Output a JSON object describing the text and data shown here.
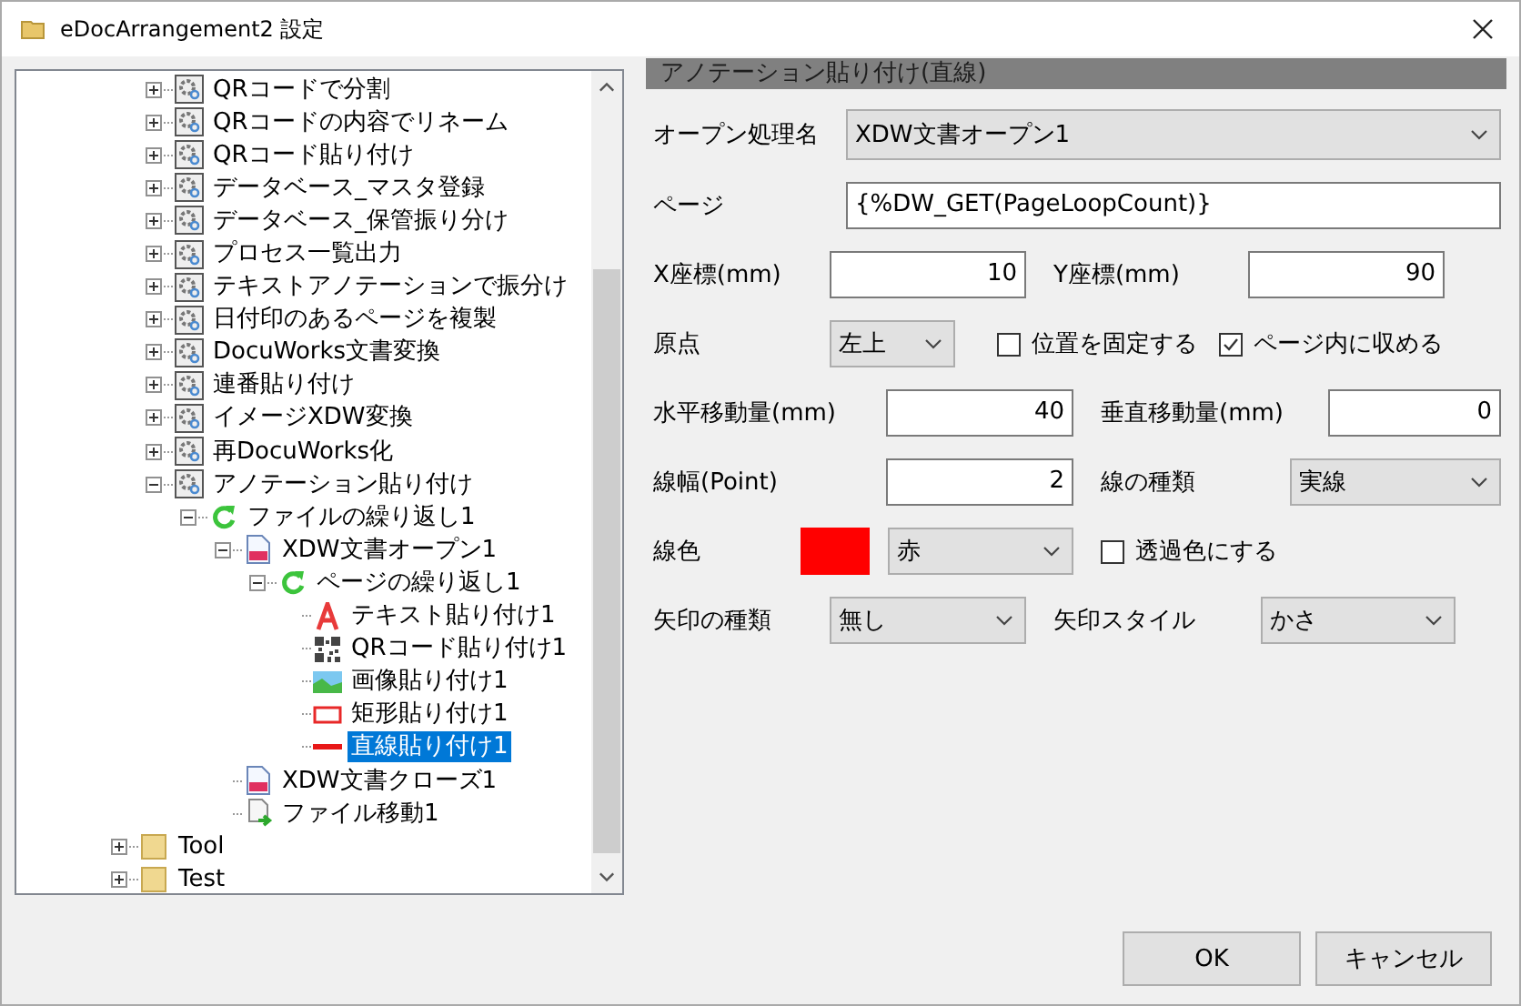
{
  "window": {
    "title": "eDocArrangement2 設定"
  },
  "tree": {
    "items": [
      {
        "children": [
          {
            "label": "QRコードで分割",
            "kind": "gear",
            "expanded": false,
            "selected": false
          },
          {
            "label": "QRコードの内容でリネーム",
            "kind": "gear",
            "expanded": false,
            "selected": false
          },
          {
            "label": "QRコード貼り付け",
            "kind": "gear",
            "expanded": false,
            "selected": false
          },
          {
            "label": "データベース_マスタ登録",
            "kind": "gear",
            "expanded": false,
            "selected": false
          },
          {
            "label": "データベース_保管振り分け",
            "kind": "gear",
            "expanded": false,
            "selected": false
          },
          {
            "label": "プロセス一覧出力",
            "kind": "gear",
            "expanded": false,
            "selected": false
          },
          {
            "label": "テキストアノテーションで振分け",
            "kind": "gear",
            "expanded": false,
            "selected": false
          },
          {
            "label": "日付印のあるページを複製",
            "kind": "gear",
            "expanded": false,
            "selected": false
          },
          {
            "label": "DocuWorks文書変換",
            "kind": "gear",
            "expanded": false,
            "selected": false
          },
          {
            "label": "連番貼り付け",
            "kind": "gear",
            "expanded": false,
            "selected": false
          },
          {
            "label": "イメージXDW変換",
            "kind": "gear",
            "expanded": false,
            "selected": false
          },
          {
            "label": "再DocuWorks化",
            "kind": "gear",
            "expanded": false,
            "selected": false
          },
          {
            "label": "アノテーション貼り付け",
            "kind": "gear",
            "expanded": true,
            "selected": false,
            "children": [
              {
                "label": "ファイルの繰り返し1",
                "kind": "loop",
                "expanded": true,
                "selected": false,
                "children": [
                  {
                    "label": "XDW文書オープン1",
                    "kind": "doc",
                    "expanded": true,
                    "selected": false,
                    "children": [
                      {
                        "label": "ページの繰り返し1",
                        "kind": "loop",
                        "expanded": true,
                        "selected": false,
                        "children": [
                          {
                            "label": "テキスト貼り付け1",
                            "kind": "text",
                            "selected": false
                          },
                          {
                            "label": "QRコード貼り付け1",
                            "kind": "qr",
                            "selected": false
                          },
                          {
                            "label": "画像貼り付け1",
                            "kind": "image",
                            "selected": false
                          },
                          {
                            "label": "矩形貼り付け1",
                            "kind": "rect",
                            "selected": false
                          },
                          {
                            "label": "直線貼り付け1",
                            "kind": "line",
                            "selected": true
                          }
                        ]
                      }
                    ]
                  },
                  {
                    "label": "XDW文書クローズ1",
                    "kind": "doc",
                    "selected": false
                  },
                  {
                    "label": "ファイル移動1",
                    "kind": "move",
                    "selected": false
                  }
                ]
              }
            ]
          }
        ]
      },
      {
        "label": "Tool",
        "kind": "folder",
        "expanded": false,
        "selected": false
      },
      {
        "label": "Test",
        "kind": "folder",
        "expanded": false,
        "selected": false
      }
    ]
  },
  "form": {
    "title": "アノテーション貼り付け(直線)",
    "rows": [
      [
        {
          "kind": "label",
          "text": "オープン処理名"
        },
        {
          "kind": "select",
          "value": "XDW文書オープン1"
        }
      ],
      [
        {
          "kind": "label",
          "text": "ページ"
        },
        {
          "kind": "text_input",
          "value": "{%DW_GET(PageLoopCount)}"
        }
      ],
      [
        {
          "kind": "label",
          "text": "X座標(mm)"
        },
        {
          "kind": "number_input",
          "value": "10"
        },
        {
          "kind": "label",
          "text": "Y座標(mm)"
        },
        {
          "kind": "number_input",
          "value": "90"
        }
      ],
      [
        {
          "kind": "label",
          "text": "原点"
        },
        {
          "kind": "select",
          "value": "左上"
        },
        {
          "kind": "checkbox",
          "label": "位置を固定する",
          "checked": false
        },
        {
          "kind": "checkbox",
          "label": "ページ内に収める",
          "checked": true
        }
      ],
      [
        {
          "kind": "label",
          "text": "水平移動量(mm)"
        },
        {
          "kind": "number_input",
          "value": "40"
        },
        {
          "kind": "label",
          "text": "垂直移動量(mm)"
        },
        {
          "kind": "number_input",
          "value": "0"
        }
      ],
      [
        {
          "kind": "label",
          "text": "線幅(Point)"
        },
        {
          "kind": "number_input",
          "value": "2"
        },
        {
          "kind": "label",
          "text": "線の種類"
        },
        {
          "kind": "select",
          "value": "実線"
        }
      ],
      [
        {
          "kind": "label",
          "text": "線色"
        },
        {
          "kind": "swatch",
          "color": "#ff0000"
        },
        {
          "kind": "select",
          "value": "赤"
        },
        {
          "kind": "checkbox",
          "label": "透過色にする",
          "checked": false
        }
      ],
      [
        {
          "kind": "label",
          "text": "矢印の種類"
        },
        {
          "kind": "select",
          "value": "無し"
        },
        {
          "kind": "label",
          "text": "矢印スタイル"
        },
        {
          "kind": "select",
          "value": "かさ"
        }
      ]
    ]
  },
  "buttons": [
    "OK",
    "キャンセル"
  ]
}
